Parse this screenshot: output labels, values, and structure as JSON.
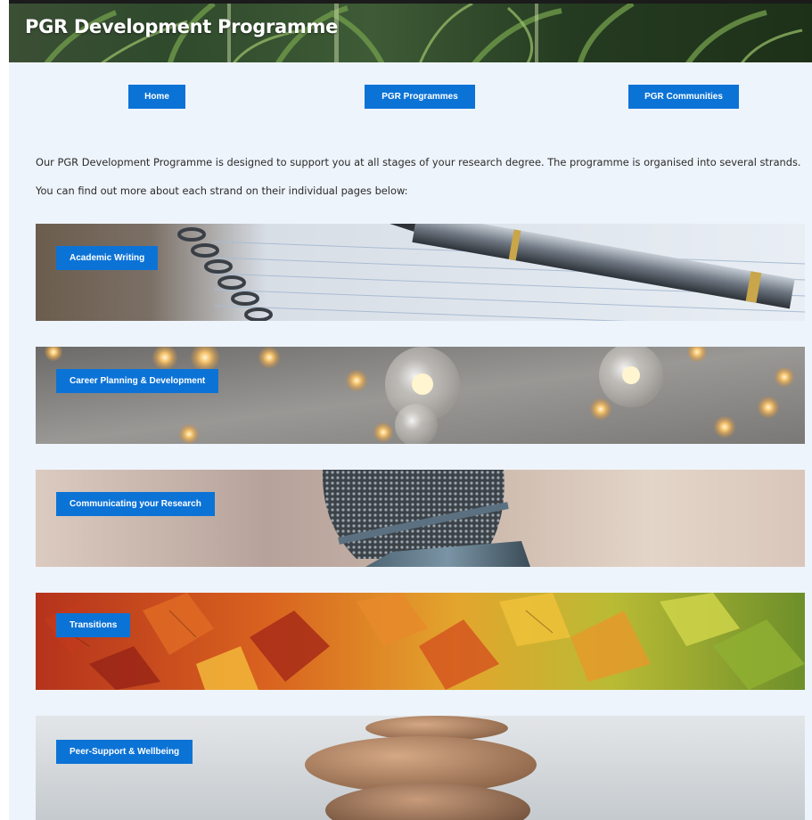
{
  "header": {
    "title": "PGR Development Programme"
  },
  "nav": [
    {
      "label": "Home"
    },
    {
      "label": "PGR Programmes"
    },
    {
      "label": "PGR Communities"
    }
  ],
  "intro": {
    "line1": "Our PGR Development Programme is designed to support you at all stages of your research degree. The programme is organised into several strands.",
    "line2": "You can find out more about each strand on their individual pages below:"
  },
  "strands": [
    {
      "label": "Academic Writing",
      "image": "notebook-and-fountain-pen"
    },
    {
      "label": "Career Planning & Development",
      "image": "glowing-light-bulbs"
    },
    {
      "label": "Communicating your Research",
      "image": "microphone"
    },
    {
      "label": "Transitions",
      "image": "autumn-leaves"
    },
    {
      "label": "Peer-Support & Wellbeing",
      "image": "balanced-stones"
    }
  ],
  "colors": {
    "accent": "#0c73d6",
    "page_background": "#eef4fb"
  }
}
